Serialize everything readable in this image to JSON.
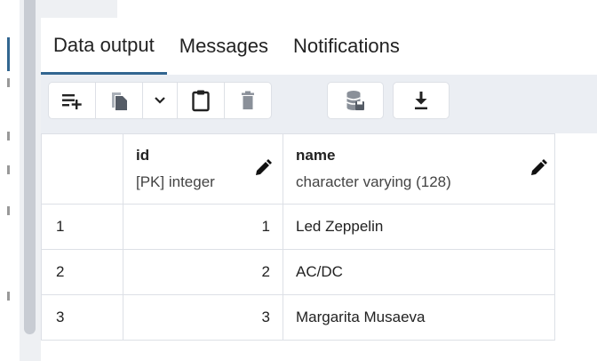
{
  "tabs": [
    {
      "label": "Data output",
      "active": true
    },
    {
      "label": "Messages",
      "active": false
    },
    {
      "label": "Notifications",
      "active": false
    }
  ],
  "toolbar": {
    "icons": [
      "add-row-icon",
      "copy-icon",
      "chevron-down-icon",
      "paste-icon",
      "delete-icon",
      "save-data-icon",
      "download-icon"
    ]
  },
  "grid": {
    "columns": [
      {
        "name": "id",
        "type": "[PK] integer"
      },
      {
        "name": "name",
        "type": "character varying (128)"
      }
    ],
    "rows": [
      {
        "num": "1",
        "id": "1",
        "name": "Led Zeppelin"
      },
      {
        "num": "2",
        "id": "2",
        "name": "AC/DC"
      },
      {
        "num": "3",
        "id": "3",
        "name": "Margarita Musaeva"
      }
    ]
  },
  "colors": {
    "accent": "#326690",
    "toolbar_bg": "#ebeef3",
    "border": "#dde0e6"
  }
}
